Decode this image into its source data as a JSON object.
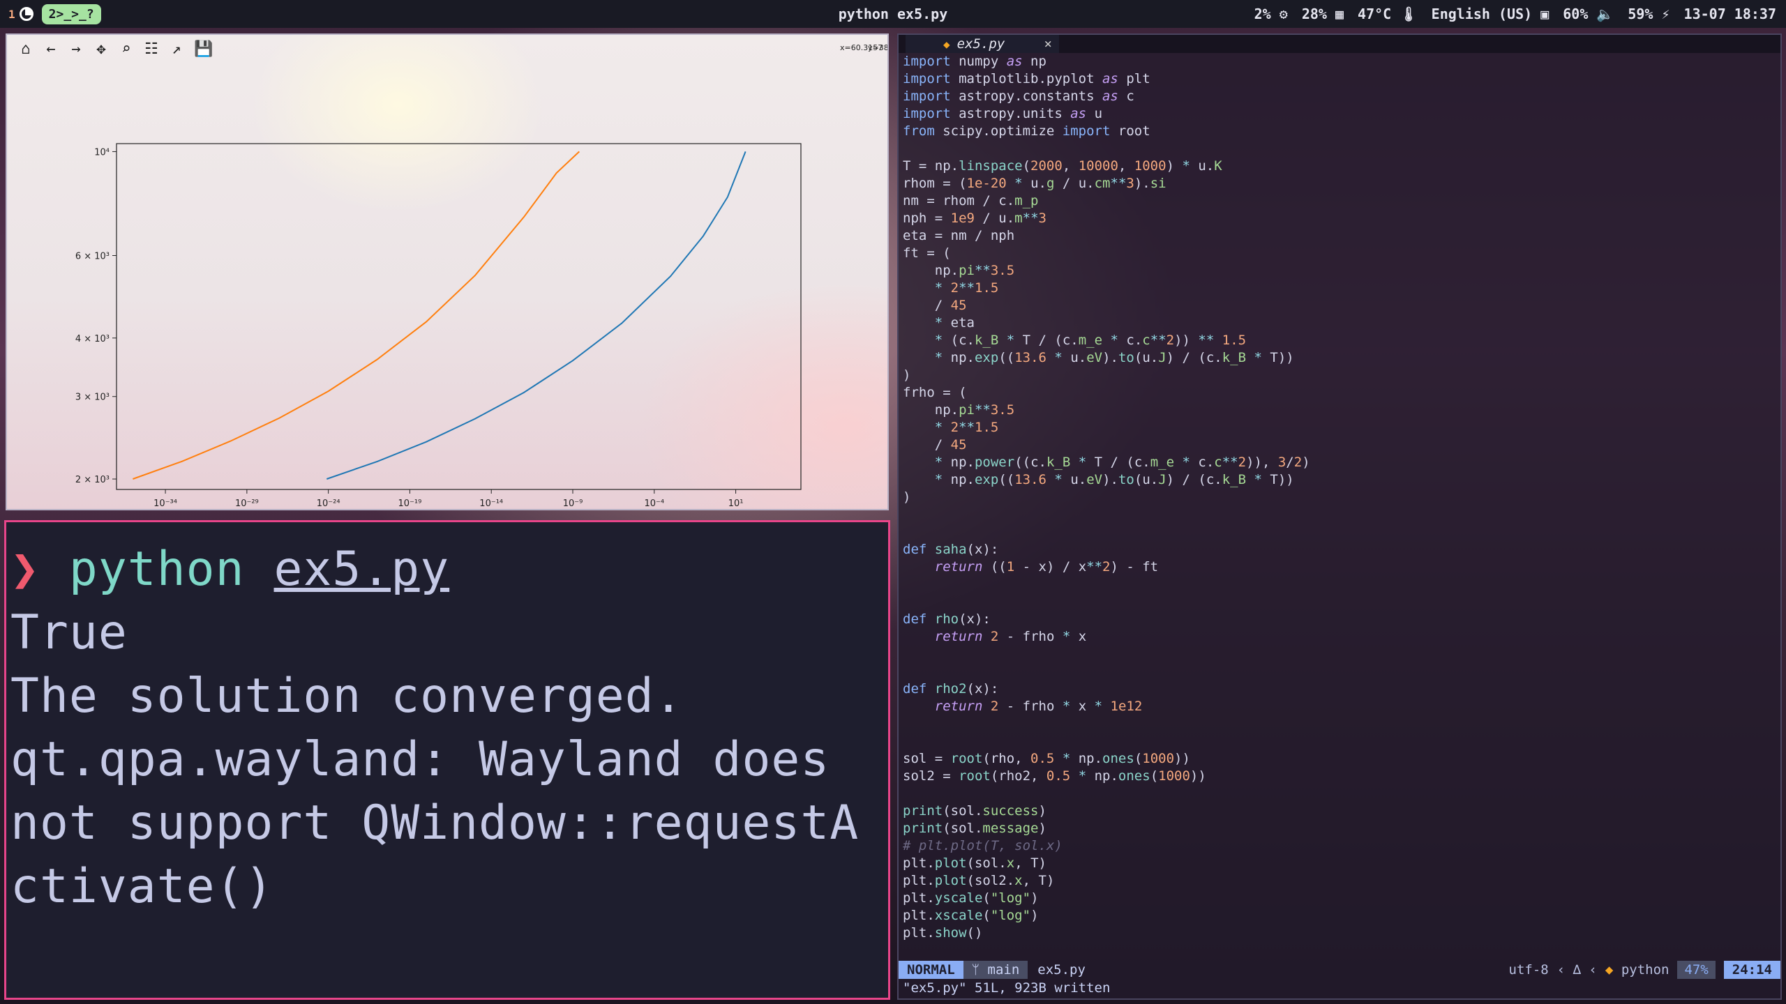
{
  "topbar": {
    "workspace_number": "1",
    "badge": "2>_>_?",
    "window_title": "python ex5.py",
    "status": [
      "2%",
      "28%",
      "47°C",
      "English (US)",
      "60%",
      "59%",
      "13-07 18:37"
    ]
  },
  "plot_window": {
    "toolbar_icons": [
      "home-icon",
      "back-icon",
      "forward-icon",
      "pan-icon",
      "zoom-icon",
      "configure-subplots-icon",
      "edit-axis-icon",
      "save-icon"
    ],
    "coord_x": "x=60.3157",
    "coord_y": "y=3832.84"
  },
  "chart_data": {
    "type": "line",
    "xscale": "log",
    "yscale": "log",
    "xlim": [
      1e-37,
      100000.0
    ],
    "ylim": [
      1900,
      10400
    ],
    "x_ticks": [
      "10⁻³⁴",
      "10⁻²⁹",
      "10⁻²⁴",
      "10⁻¹⁹",
      "10⁻¹⁴",
      "10⁻⁹",
      "10⁻⁴",
      "10¹"
    ],
    "x_tick_values": [
      -34,
      -29,
      -24,
      -19,
      -14,
      -9,
      -4,
      1
    ],
    "y_ticks": [
      "10⁴",
      "6 × 10³",
      "4 × 10³",
      "3 × 10³",
      "2 × 10³"
    ],
    "y_tick_values": [
      10000,
      6000,
      4000,
      3000,
      2000
    ],
    "series": [
      {
        "color": "#ff7f0e",
        "log10x": [
          -36,
          -33,
          -30,
          -27,
          -24,
          -21,
          -18,
          -15,
          -12,
          -10,
          -8.6
        ],
        "y": [
          2000,
          2180,
          2410,
          2700,
          3080,
          3600,
          4330,
          5440,
          7250,
          9000,
          10000
        ]
      },
      {
        "color": "#1f77b4",
        "log10x": [
          -24.1,
          -21,
          -18,
          -15,
          -12,
          -9,
          -6,
          -3,
          -1,
          0.5,
          1.6
        ],
        "y": [
          2000,
          2180,
          2400,
          2690,
          3060,
          3580,
          4300,
          5420,
          6600,
          8000,
          10000
        ]
      }
    ]
  },
  "terminal": {
    "prompt": "❯",
    "command": "python",
    "argument": "ex5.py",
    "output": [
      "True",
      "The solution converged.",
      "qt.qpa.wayland: Wayland does not support QWindow::requestActivate()"
    ]
  },
  "editor": {
    "tab_name": "ex5.py",
    "close": "×",
    "mode": "NORMAL",
    "branch": "main",
    "file": "ex5.py",
    "encoding": "utf-8",
    "filetype": "python",
    "percent": "47%",
    "position": "24:14",
    "message": "\"ex5.py\" 51L, 923B written"
  }
}
